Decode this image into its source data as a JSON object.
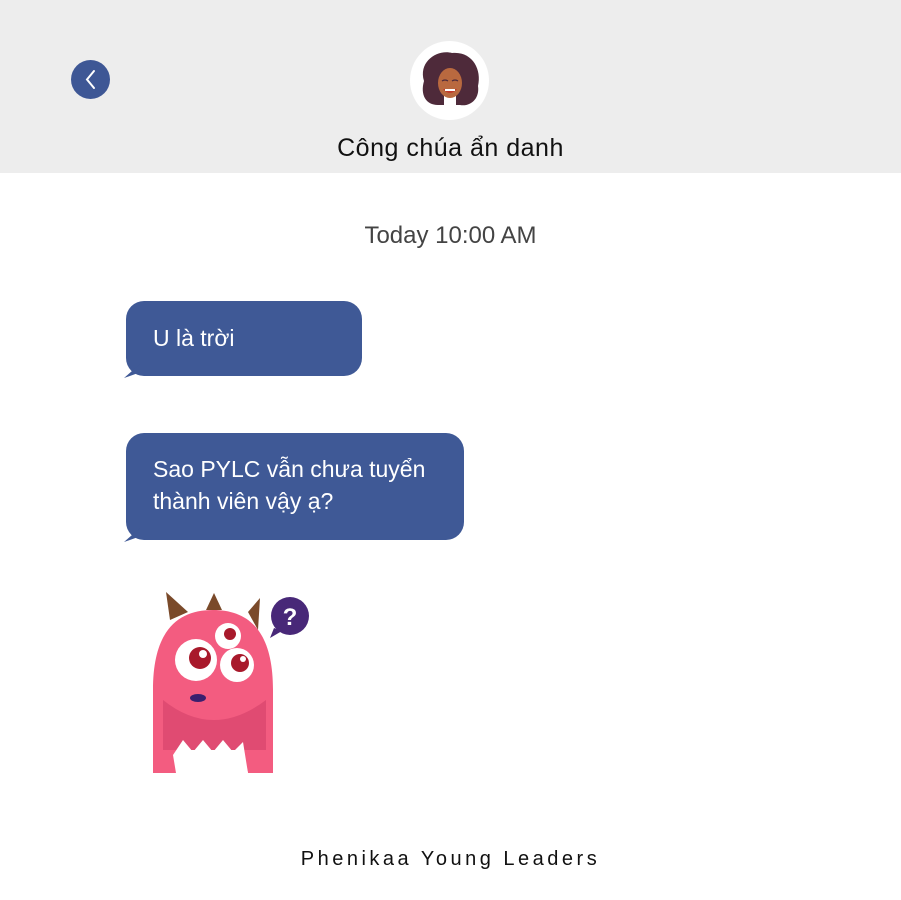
{
  "header": {
    "contact_name": "Công chúa ẩn danh",
    "back_icon": "chevron-left-icon",
    "accent": "#3e5795"
  },
  "chat": {
    "timestamp": "Today 10:00 AM",
    "messages": [
      {
        "text": "U là trời"
      },
      {
        "text": "Sao PYLC vẫn chưa tuyển thành viên vậy ạ?"
      }
    ],
    "sticker_text": "?"
  },
  "footer": {
    "brand": "Phenikaa Young Leaders"
  }
}
